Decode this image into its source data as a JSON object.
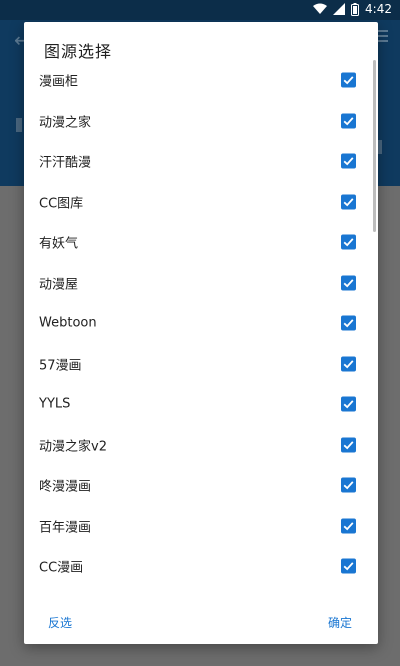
{
  "status_bar": {
    "time": "4:42",
    "icons": [
      "wifi-icon",
      "signal-icon",
      "battery-icon"
    ]
  },
  "dialog": {
    "title": "图源选择",
    "items": [
      {
        "label": "漫画柜",
        "checked": true
      },
      {
        "label": "动漫之家",
        "checked": true
      },
      {
        "label": "汗汗酷漫",
        "checked": true
      },
      {
        "label": "CC图库",
        "checked": true
      },
      {
        "label": "有妖气",
        "checked": true
      },
      {
        "label": "动漫屋",
        "checked": true
      },
      {
        "label": "Webtoon",
        "checked": true
      },
      {
        "label": "57漫画",
        "checked": true
      },
      {
        "label": "YYLS",
        "checked": true
      },
      {
        "label": "动漫之家v2",
        "checked": true
      },
      {
        "label": "咚漫漫画",
        "checked": true
      },
      {
        "label": "百年漫画",
        "checked": true
      },
      {
        "label": "CC漫画",
        "checked": true
      }
    ],
    "actions": {
      "invert_label": "反选",
      "confirm_label": "确定"
    }
  },
  "colors": {
    "accent": "#1976d2",
    "app_bar": "#0f3a5f",
    "scrim": "#6f6f6f"
  }
}
